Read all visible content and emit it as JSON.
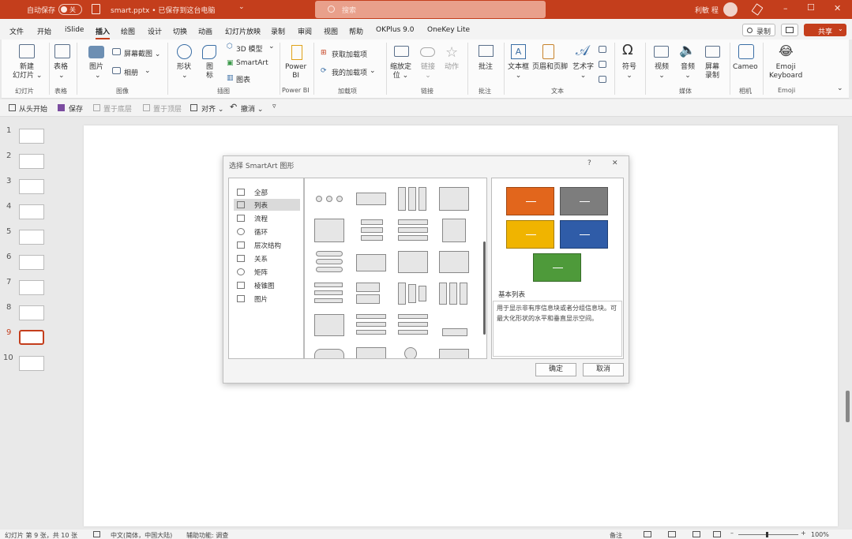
{
  "titlebar": {
    "autosave_label": "自动保存",
    "autosave_state": "关",
    "file_title": "smart.pptx • 已保存到这台电脑",
    "chevron": "⌄",
    "search_placeholder": "搜索",
    "user_name": "利敏 程",
    "min_glyph": "–",
    "max_glyph": "☐",
    "close_glyph": "✕",
    "bg_color": "#c43e1c"
  },
  "menu": {
    "tabs": [
      "文件",
      "开始",
      "iSlide",
      "插入",
      "绘图",
      "设计",
      "切换",
      "动画",
      "幻灯片放映",
      "录制",
      "审阅",
      "视图",
      "帮助",
      "OKPlus 9.0",
      "OneKey Lite"
    ],
    "active_tab": "插入",
    "record_label": "录制",
    "share_label": "共享"
  },
  "ribbon": {
    "new_slide": "新建\n幻灯片 ⌄",
    "table": "表格",
    "table_caret": "⌄",
    "picture": "图片",
    "picture_caret": "⌄",
    "screenshot": "屏幕截图 ⌄",
    "album": "相册",
    "album_caret": "⌄",
    "shape": "形状",
    "shape_caret": "⌄",
    "icon": "图\n标",
    "model3d": "3D 模型",
    "model3d_caret": "⌄",
    "smartart": "SmartArt",
    "chart": "图表",
    "powerbi": "Power\nBI",
    "get_addins": "获取加载项",
    "my_addins": "我的加载项",
    "my_addins_caret": "⌄",
    "zoom": "缩放定\n位 ⌄",
    "link": "链接\n⌄",
    "action": "动作",
    "comment": "批注",
    "textbox": "文本框\n⌄",
    "header_footer": "页眉和页脚",
    "wordart": "艺术字\n⌄",
    "symbols": "符号\n⌄",
    "video": "视频\n⌄",
    "audio": "音频\n⌄",
    "screen_record": "屏幕\n录制",
    "cameo": "Cameo",
    "emoji": "Emoji\nKeyboard",
    "emoji_face": "😂",
    "collapse": "⌄",
    "groups": [
      "幻灯片",
      "表格",
      "图像",
      "插图",
      "Power BI",
      "加载项",
      "链接",
      "批注",
      "文本",
      "媒体",
      "相机",
      "Emoji"
    ]
  },
  "qat": {
    "from_start": "从头开始",
    "save": "保存",
    "bring_forward": "置于底层",
    "send_backward": "置于顶层",
    "align": "对齐 ⌄",
    "undo": "撤消 ⌄",
    "more": "▿"
  },
  "thumbnails": {
    "numbers": [
      "1",
      "2",
      "3",
      "4",
      "5",
      "6",
      "7",
      "8",
      "9",
      "10"
    ],
    "selected": "9"
  },
  "dialog": {
    "title": "选择 SmartArt 图形",
    "help": "?",
    "close": "✕",
    "categories": [
      "全部",
      "列表",
      "流程",
      "循环",
      "层次结构",
      "关系",
      "矩阵",
      "棱锥图",
      "图片"
    ],
    "selected_category": "列表",
    "preview_title": "基本列表",
    "description": "用于显示非有序信息块或者分组信息块。可最大化形状的水平和垂直显示空间。",
    "ok": "确定",
    "cancel": "取消",
    "preview_colors": [
      "#e2661c",
      "#7d7d7d",
      "#f0b400",
      "#2f5ca8",
      "#4e9a3a"
    ]
  },
  "status": {
    "slide_pos": "幻灯片 第 9 张，共 10 张",
    "language": "中文(简体，中国大陆)",
    "accessibility": "辅助功能: 调查",
    "notes": "备注",
    "zoom": "100%",
    "zoom_minus": "–",
    "zoom_plus": "+"
  }
}
